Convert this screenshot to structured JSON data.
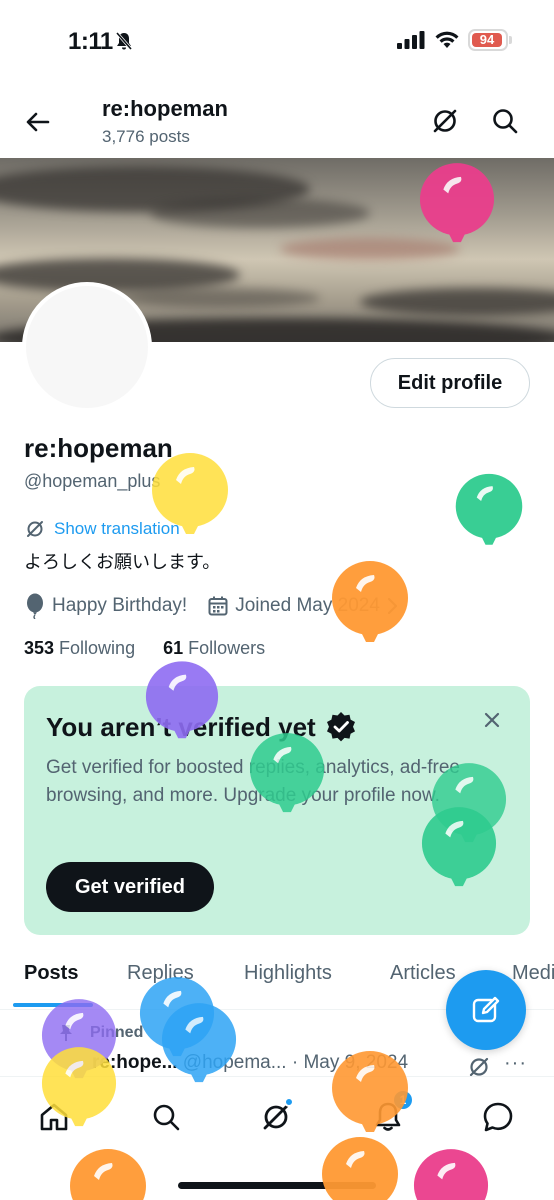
{
  "status_bar": {
    "time": "1:11",
    "battery": "94"
  },
  "header": {
    "title": "re:hopeman",
    "posts_count": "3,776 posts"
  },
  "profile": {
    "edit_button": "Edit profile",
    "name": "re:hopeman",
    "handle": "@hopeman_plus",
    "translation_link": "Show translation",
    "bio": "よろしくお願いします。",
    "birthday": "Happy Birthday!",
    "joined": "Joined May 2024",
    "following_count": "353",
    "following_label": "Following",
    "followers_count": "61",
    "followers_label": "Followers"
  },
  "verify_card": {
    "title": "You aren’t verified yet",
    "description": "Get verified for boosted replies, analytics, ad-free browsing, and more. Upgrade your profile now.",
    "button": "Get verified"
  },
  "tabs": [
    "Posts",
    "Replies",
    "Highlights",
    "Articles",
    "Media"
  ],
  "active_tab": "Posts",
  "pinned_post": {
    "pinned_label": "Pinned",
    "name": "re:hope...",
    "handle": "@hopema...",
    "date": "· May 9, 2024",
    "more": "···"
  },
  "nav": {
    "notification_badge": "1"
  },
  "colors": {
    "accent": "#1d9bf0",
    "verify_card_bg": "#c7f1dd",
    "balloon_colors": [
      "#ea3e8c",
      "#ffdf3a",
      "#2fcc8f",
      "#ff9933",
      "#8e6cf2",
      "#2ea4f5"
    ]
  }
}
